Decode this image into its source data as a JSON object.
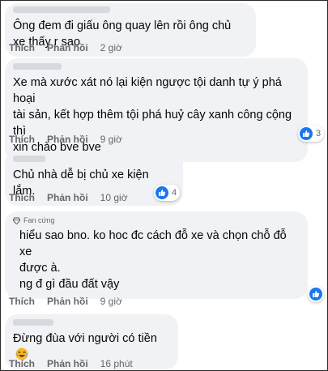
{
  "comments": [
    {
      "text": "Ông đem đi giấu ông quay lên rồi ông chủ xe thấy r sao",
      "actions": {
        "like": "Thích",
        "reply": "Phản hồi",
        "time": "2 giờ"
      }
    },
    {
      "text": "Xe mà xước xát nó lại kiện ngược tội danh tự ý phá hoại\ntài sản, kết hợp thêm tội phá huỷ cây xanh công cộng thì\nxin chào bye bye",
      "reactions": {
        "count": "3"
      },
      "actions": {
        "like": "Thích",
        "reply": "Phản hồi",
        "time": "9 giờ"
      }
    },
    {
      "text": "Chủ nhà dễ bị chủ xe kiện lắm.",
      "reactions": {
        "count": "4"
      },
      "actions": {
        "like": "Thích",
        "reply": "Phản hồi",
        "time": "10 giờ"
      }
    },
    {
      "badge": "Fan cứng",
      "text": "hiểu sao bno. ko hoc đc cách đỗ xe và chọn chỗ đỗ xe\nđược à.\nng đ gì đầu đất vậy",
      "actions": {
        "like": "Thích",
        "reply": "Phản hồi",
        "time": "9 giờ"
      }
    },
    {
      "text": "Đừng đùa với người có tiền",
      "actions": {
        "like": "Thích",
        "reply": "Phản hồi",
        "time": "16 phút"
      }
    }
  ],
  "colors": {
    "bubble": "#f0f2f5",
    "like_blue": "#1877f2",
    "meta_gray": "#65676b"
  },
  "icons": {
    "like": "thumbs-up-icon",
    "badge": "diamond-icon",
    "emoji": "laughing-face-icon"
  }
}
